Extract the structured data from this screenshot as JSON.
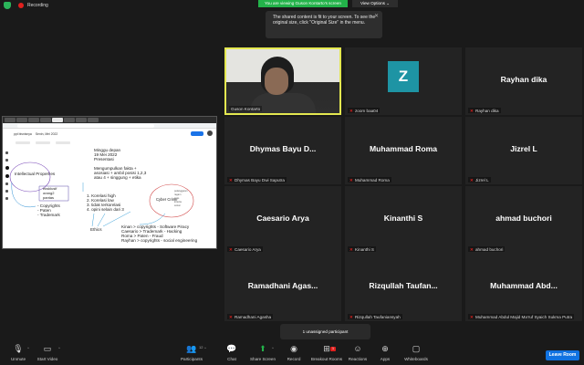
{
  "topbar": {
    "recording_label": "Recording",
    "viewing_banner": "You are viewing Guson Kontarto's screen",
    "view_options": "View Options"
  },
  "tooltip": {
    "text": "The shared content is fit to your screen. To see the original size, click \"Original Size\" in the menu."
  },
  "shared_screen": {
    "doc_title": "ppt bisnisnya",
    "doc_date": "Senin, Mei 2022",
    "notes": {
      "header_lines": [
        "Minggu depan",
        "19 Mei 2022",
        "Presentasi"
      ],
      "collect_lines": [
        "Mengumpulkan fakta +",
        "asosiasi + ambil posisi 1,2,3",
        "atau 4 + singgung + etika"
      ],
      "ip_label": "Intellectual Properties",
      "ip_items": [
        "eksklusif",
        "orang2",
        "pantas"
      ],
      "ip_list": [
        "- Copyrights",
        "- Paten",
        "- Trademark"
      ],
      "correlation": [
        "1. Korelasi high",
        "2. Korelasi low",
        "3. tidak terkorelasi",
        "4. opini selain dari 3"
      ],
      "cyber": "Cyber Crime",
      "cyber_note": [
        "pelanggaran",
        "ragam",
        "jenis",
        "kriteria",
        "solusi"
      ],
      "ethics": "Ethics",
      "assignments": [
        "Kinan > copyrights - Software Piracy",
        "Caesario > Trademark - Hacking",
        "Roma > Paten - Fraud",
        "Rayhan > copyrights - social engineering"
      ]
    }
  },
  "tiles": [
    {
      "display": "",
      "label": "Guson Kontarto",
      "mic_off": false,
      "type": "video"
    },
    {
      "display": "Z",
      "label": "zoom baa04",
      "mic_off": true,
      "type": "avatar"
    },
    {
      "display": "Rayhan dika",
      "label": "Rayhan dika",
      "mic_off": true,
      "type": "name"
    },
    {
      "display": "Dhymas Bayu D...",
      "label": "Dhymas Bayu Dwi Saputra",
      "mic_off": true,
      "type": "name"
    },
    {
      "display": "Muhammad Roma",
      "label": "Muhammad Roma",
      "mic_off": true,
      "type": "name"
    },
    {
      "display": "Jizrel L",
      "label": "Jizrel L",
      "mic_off": true,
      "type": "name"
    },
    {
      "display": "Caesario Arya",
      "label": "Caesario Arya",
      "mic_off": true,
      "type": "name"
    },
    {
      "display": "Kinanthi S",
      "label": "Kinanthi S",
      "mic_off": true,
      "type": "name"
    },
    {
      "display": "ahmad buchori",
      "label": "ahmad buchori",
      "mic_off": true,
      "type": "name"
    },
    {
      "display": "Ramadhani Agas...",
      "label": "Ramadhani Agasha",
      "mic_off": true,
      "type": "name"
    },
    {
      "display": "Rizqullah Taufan...",
      "label": "Rizqullah Taufaniansyah",
      "mic_off": true,
      "type": "name"
    },
    {
      "display": "Muhammad Abd...",
      "label": "Muhammad Abdul Majid Ma'ruf Syaich Sukma Putra",
      "mic_off": true,
      "type": "name"
    }
  ],
  "unassigned": "1 unassigned participant",
  "toolbar": {
    "unmute": "Unmute",
    "start_video": "Start Video",
    "participants": "Participants",
    "participants_count": "12",
    "chat": "Chat",
    "share_screen": "Share Screen",
    "record": "Record",
    "breakout_rooms": "Breakout Rooms",
    "breakout_badge": "1",
    "reactions": "Reactions",
    "apps": "Apps",
    "whiteboards": "Whiteboards",
    "leave": "Leave Room"
  },
  "colors": {
    "accent_green": "#23b34a",
    "active_speaker": "#e4e850",
    "leave_blue": "#1072e1",
    "mute_red": "#e0201e",
    "z_avatar": "#1e94a4"
  }
}
